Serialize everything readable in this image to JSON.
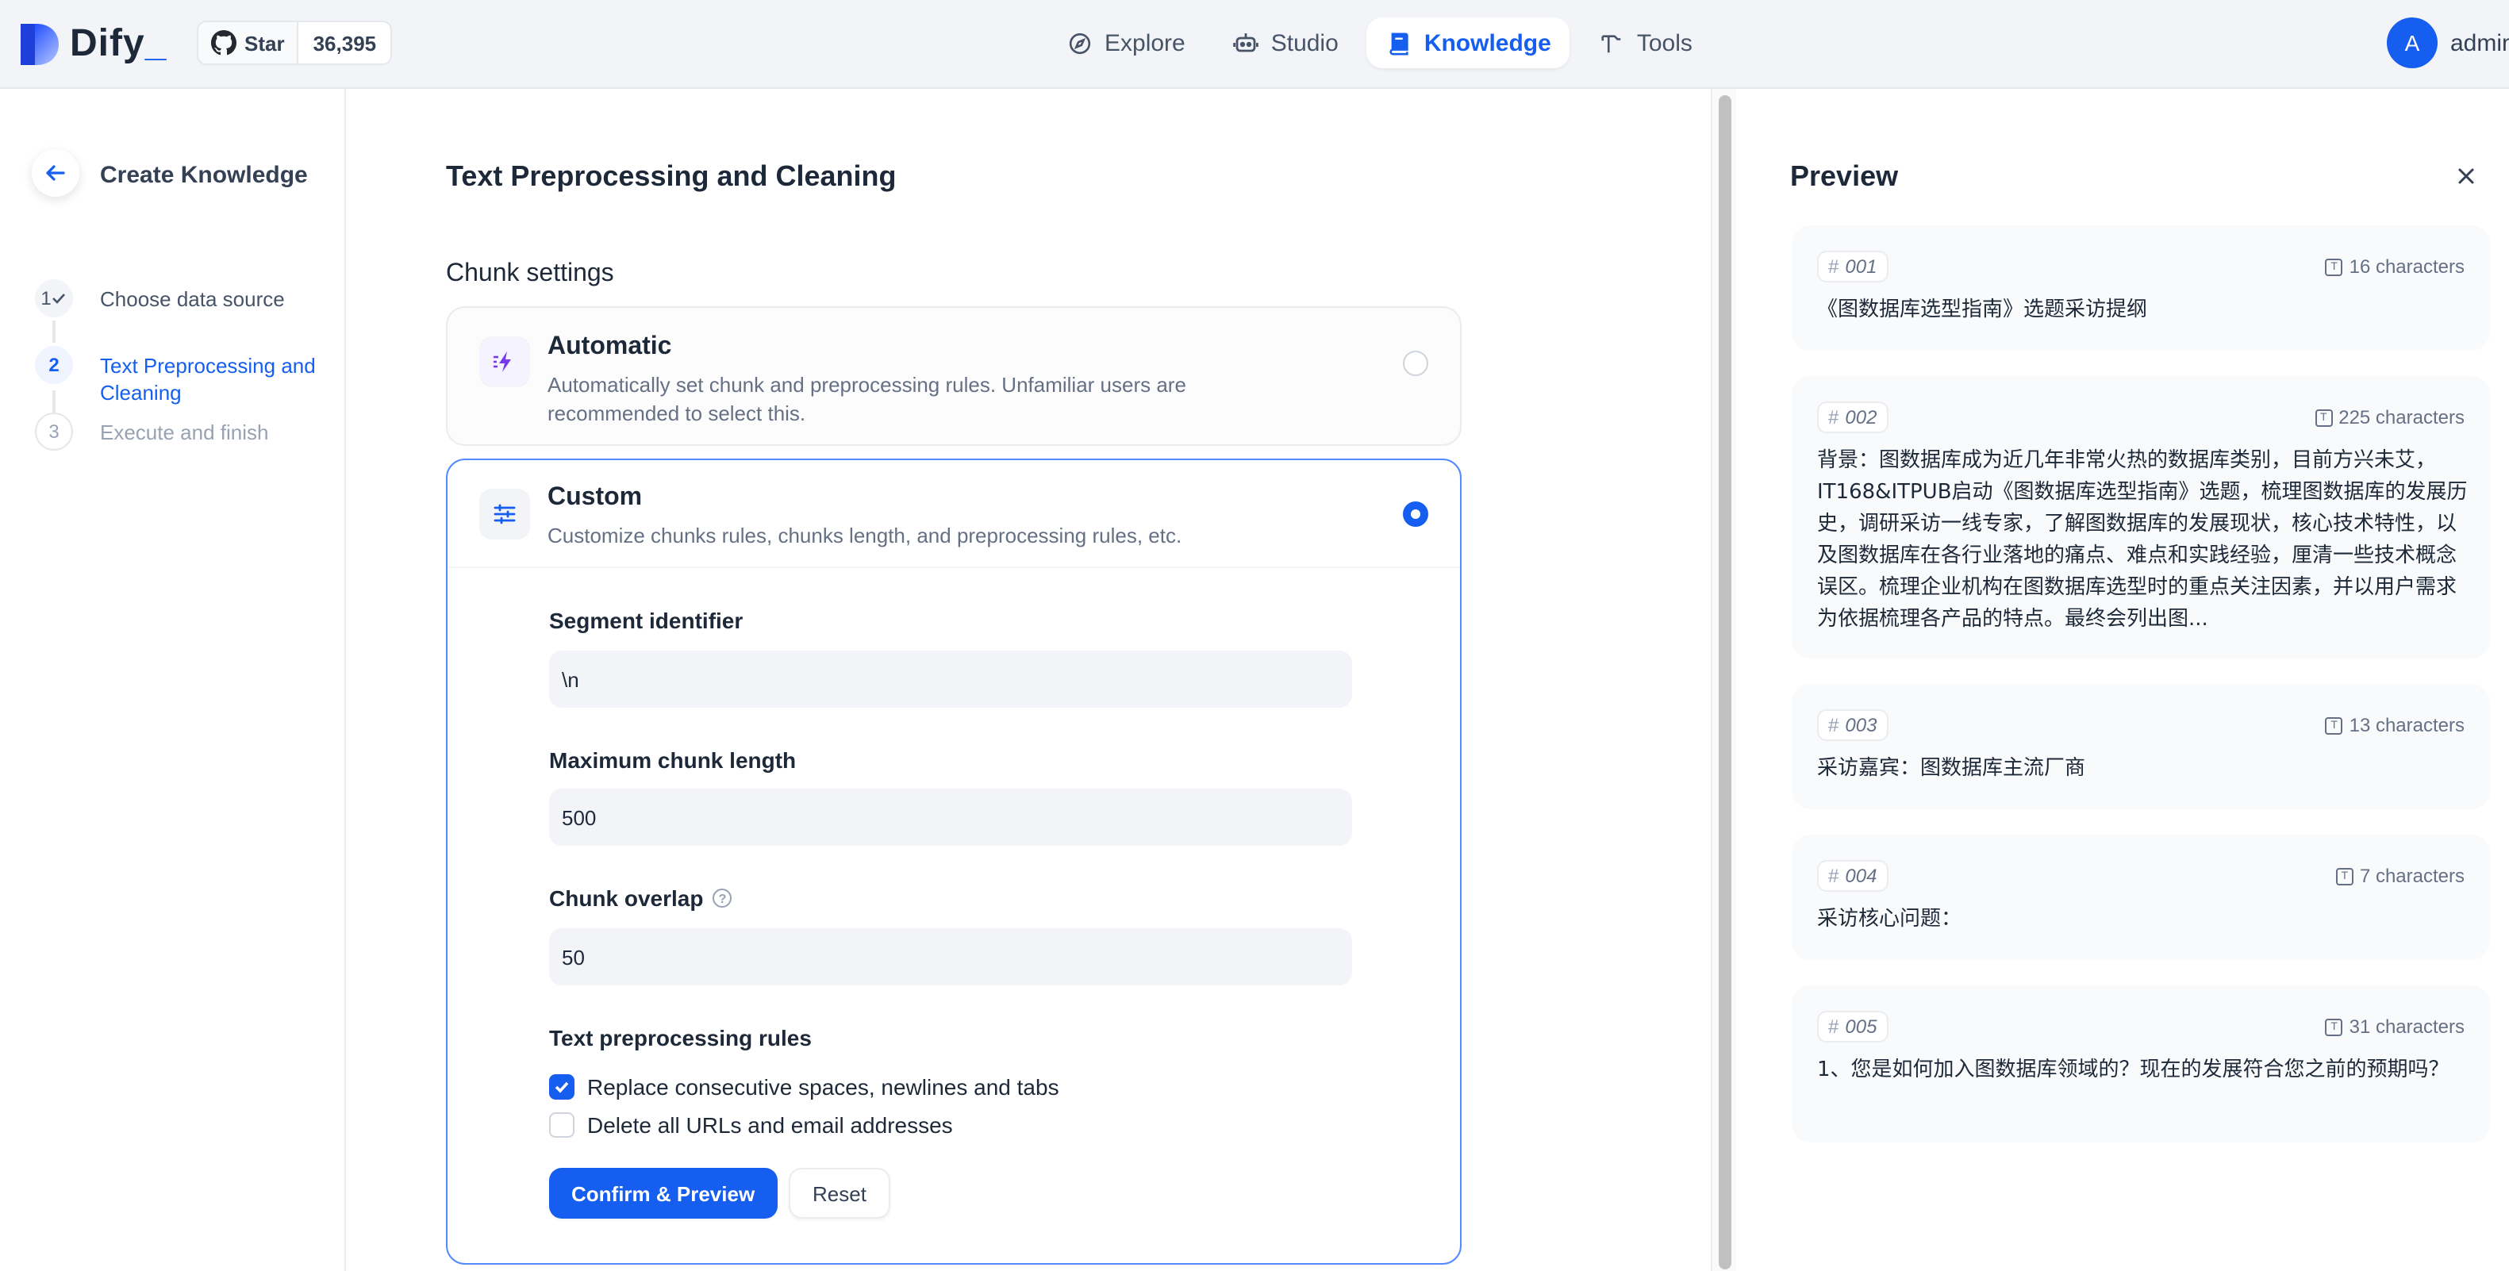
{
  "header": {
    "logo_text": "Dify",
    "logo_accent": "_",
    "github": {
      "star_label": "Star",
      "star_count": "36,395"
    },
    "nav": [
      {
        "label": "Explore",
        "icon": "compass-icon",
        "active": false
      },
      {
        "label": "Studio",
        "icon": "robot-icon",
        "active": false
      },
      {
        "label": "Knowledge",
        "icon": "book-icon",
        "active": true
      },
      {
        "label": "Tools",
        "icon": "hammer-icon",
        "active": false
      }
    ],
    "user": {
      "avatar_letter": "A",
      "name": "admin"
    }
  },
  "sidebar": {
    "title": "Create Knowledge",
    "steps": [
      {
        "num": "1",
        "label": "Choose data source",
        "status": "done"
      },
      {
        "num": "2",
        "label": "Text Preprocessing and Cleaning",
        "status": "current"
      },
      {
        "num": "3",
        "label": "Execute and finish",
        "status": "todo"
      }
    ]
  },
  "main": {
    "title": "Text Preprocessing and Cleaning",
    "chunk_settings_label": "Chunk settings",
    "automatic": {
      "title": "Automatic",
      "description": "Automatically set chunk and preprocessing rules. Unfamiliar users are recommended to select this.",
      "selected": false
    },
    "custom": {
      "title": "Custom",
      "description": "Customize chunks rules, chunks length, and preprocessing rules, etc.",
      "selected": true,
      "segment_identifier_label": "Segment identifier",
      "segment_identifier_value": "\\n",
      "max_chunk_length_label": "Maximum chunk length",
      "max_chunk_length_value": "500",
      "chunk_overlap_label": "Chunk overlap",
      "chunk_overlap_value": "50",
      "preprocessing_rules_label": "Text preprocessing rules",
      "rules": [
        {
          "label": "Replace consecutive spaces, newlines and tabs",
          "checked": true
        },
        {
          "label": "Delete all URLs and email addresses",
          "checked": false
        }
      ],
      "confirm_label": "Confirm & Preview",
      "reset_label": "Reset"
    }
  },
  "preview": {
    "title": "Preview",
    "segments": [
      {
        "id": "001",
        "count": "16 characters",
        "text": "《图数据库选型指南》选题采访提纲"
      },
      {
        "id": "002",
        "count": "225 characters",
        "text": "背景：图数据库成为近几年非常火热的数据库类别，目前方兴未艾，IT168&ITPUB启动《图数据库选型指南》选题，梳理图数据库的发展历史，调研采访一线专家，了解图数据库的发展现状，核心技术特性，以及图数据库在各行业落地的痛点、难点和实践经验，厘清一些技术概念误区。梳理企业机构在图数据库选型时的重点关注因素，并以用户需求为依据梳理各产品的特点。最终会列出图..."
      },
      {
        "id": "003",
        "count": "13 characters",
        "text": "采访嘉宾：图数据库主流厂商"
      },
      {
        "id": "004",
        "count": "7 characters",
        "text": "采访核心问题："
      },
      {
        "id": "005",
        "count": "31 characters",
        "text": "1、您是如何加入图数据库领域的？现在的发展符合您之前的预期吗？"
      }
    ]
  },
  "colors": {
    "accent": "#155eef",
    "header_bg": "#f2f4f7",
    "custom_border": "#528bff"
  }
}
